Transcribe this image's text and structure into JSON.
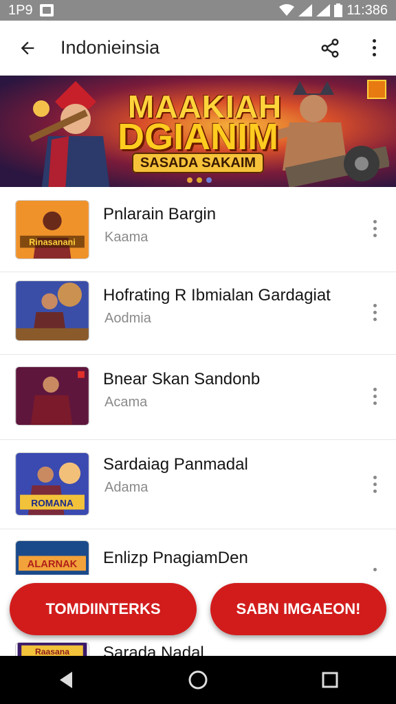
{
  "status_bar": {
    "left_text": "1P9",
    "time": "11:386"
  },
  "app_bar": {
    "title": "Indonieinsia",
    "back_icon": "arrow-back-icon",
    "share_icon": "share-icon",
    "more_icon": "more-vert-icon"
  },
  "banner": {
    "title_line1": "MAAKIAH",
    "title_line2": "DGIANIM",
    "subtitle": "SASADA SAKAIM",
    "dot_count": 3
  },
  "items": [
    {
      "title": "Pnlarain Bargin",
      "subtitle": "Kaama",
      "thumb_text": "Rinasanani"
    },
    {
      "title": "Hofrating R Ibmialan Gardagiat",
      "subtitle": "Aodmia",
      "thumb_text": ""
    },
    {
      "title": "Bnear Skan Sandonb",
      "subtitle": "Acama",
      "thumb_text": ""
    },
    {
      "title": "Sardaiag Panmadal",
      "subtitle": "Adama",
      "thumb_text": "ROMANA"
    },
    {
      "title": "Enlizp PnagiamDen",
      "subtitle": "",
      "thumb_text": "ALARNAK"
    },
    {
      "title": "Sarada Nadal",
      "subtitle": "",
      "thumb_text": "Raasana"
    }
  ],
  "actions": {
    "left_label": "TOMDIINTERKS",
    "right_label": "SABN IMGAEON!"
  },
  "colors": {
    "accent": "#d21c1c",
    "status_bar": "#8a8a8a",
    "nav_bar": "#000000"
  }
}
